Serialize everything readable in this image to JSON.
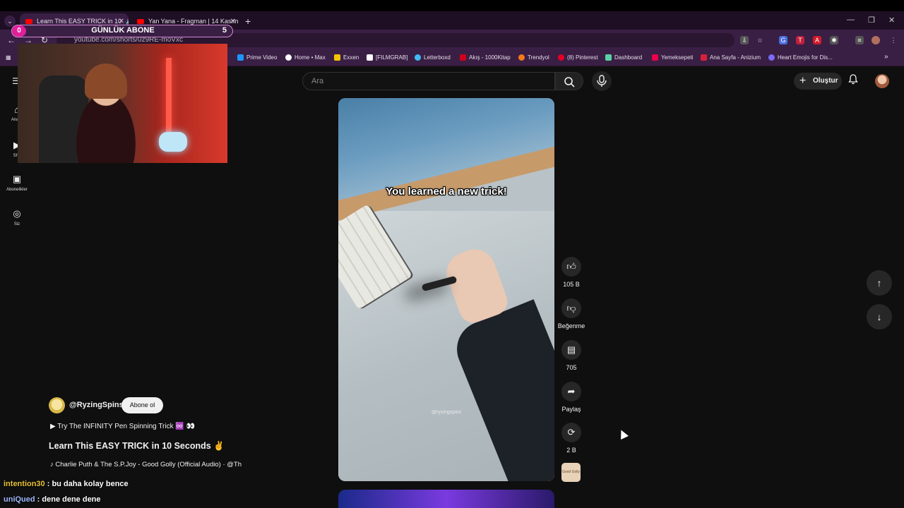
{
  "browser": {
    "tabs": [
      {
        "title": "Learn This EASY TRICK in 10",
        "active": true
      },
      {
        "title": "Yan Yana - Fragman | 14 Kasım",
        "active": false
      }
    ],
    "new_tab_glyph": "+",
    "tab_menu_glyph": "⌄",
    "tab_close_glyph": "✕",
    "window_controls": [
      "—",
      "❐",
      "✕"
    ],
    "url": "youtube.com/shorts/0z9RE-moVxc",
    "nav": {
      "back": "←",
      "forward": "→",
      "reload": "↻"
    },
    "bookmarks": [
      {
        "label": "Prime Video",
        "color": "#1a98ff"
      },
      {
        "label": "Home • Max",
        "color": "#ffffff"
      },
      {
        "label": "Exxen",
        "color": "#f5c400"
      },
      {
        "label": "[FILMGRAB]",
        "color": "#ffffff"
      },
      {
        "label": "Letterboxd",
        "color": "#40bcf4"
      },
      {
        "label": "Akış - 1000Kitap",
        "color": "#d0021b"
      },
      {
        "label": "Trendyol",
        "color": "#f27a1a"
      },
      {
        "label": "(8) Pinterest",
        "color": "#e60023"
      },
      {
        "label": "Dashboard",
        "color": "#5ad2a8"
      },
      {
        "label": "Yemeksepeti",
        "color": "#ea004b"
      },
      {
        "label": "Ana Sayfa - Anizium",
        "color": "#d8203a"
      },
      {
        "label": "Heart Emojis for Dis...",
        "color": "#7b6cf6"
      }
    ],
    "more_bookmarks": "»"
  },
  "overlay": {
    "sub_counter": {
      "current": "0",
      "label": "GÜNLÜK ABONE",
      "goal": "5"
    },
    "chat": [
      {
        "user": "intention30",
        "message": " : bu daha kolay bence"
      },
      {
        "user": "uniQued",
        "message": " : dene dene dene"
      }
    ]
  },
  "youtube": {
    "sidebar": [
      {
        "label": "Ana S",
        "icon": "home-icon",
        "glyph": "⌂"
      },
      {
        "label": "Sho",
        "icon": "shorts-icon",
        "glyph": "▶"
      },
      {
        "label": "Abonelikler",
        "icon": "subscriptions-icon",
        "glyph": "▣"
      },
      {
        "label": "Siz",
        "icon": "you-icon",
        "glyph": "◎"
      }
    ],
    "menu_glyph": "☰",
    "search": {
      "placeholder": "Ara"
    },
    "create_label": "Oluştur",
    "video": {
      "caption": "You learned a new trick!",
      "watermark": "@ryzingspins"
    },
    "actions": {
      "like_count": "105 B",
      "dislike_label": "Beğenme",
      "comment_count": "705",
      "share_label": "Paylaş",
      "remix_count": "2 B"
    },
    "sound_thumb_text": "Good Golly",
    "meta": {
      "channel": "@RyzingSpins",
      "subscribe": "Abone ol",
      "playlist": "▶  Try The INFINITY Pen Spinning Trick ♾️ 👀",
      "title": "Learn This EASY TRICK in 10 Seconds ✌️",
      "music": "♪ Charlie Puth & The S.P.Joy - Good Golly (Official Audio) · @Th"
    }
  }
}
